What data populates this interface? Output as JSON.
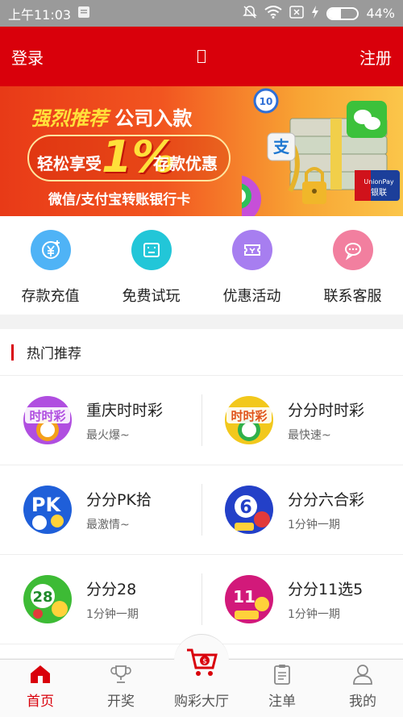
{
  "status_bar": {
    "time": "上午11:03",
    "battery_percent": "44%",
    "battery_level": 0.44
  },
  "header": {
    "login_label": "登录",
    "register_label": "注册"
  },
  "banner": {
    "line1_highlight": "强烈推荐",
    "line1_rest": "公司入款",
    "line2_prefix": "轻松享受",
    "percent": "1%",
    "line2_suffix": "存款优惠",
    "line3": "微信/支付宝转账银行卡",
    "unionpay_text": "UnionPay",
    "unionpay_cn": "银联"
  },
  "quick_actions": [
    {
      "label": "存款充值",
      "icon": "yen-plus-icon",
      "color": "#4fb3f6"
    },
    {
      "label": "免费试玩",
      "icon": "game-screen-icon",
      "color": "#22c6d8"
    },
    {
      "label": "优惠活动",
      "icon": "ticket-icon",
      "color": "#a77ef0"
    },
    {
      "label": "联系客服",
      "icon": "chat-bubble-icon",
      "color": "#f27f9f"
    }
  ],
  "section": {
    "title": "热门推荐"
  },
  "games": [
    {
      "name": "重庆时时彩",
      "desc": "最火爆~",
      "logo_color": "#b04ee0",
      "logo_text": "时时彩"
    },
    {
      "name": "分分时时彩",
      "desc": "最快速~",
      "logo_color": "#f2c81c",
      "logo_text": "时时彩"
    },
    {
      "name": "分分PK拾",
      "desc": "最激情~",
      "logo_color": "#1f5fd9",
      "logo_text": "PK"
    },
    {
      "name": "分分六合彩",
      "desc": "1分钟一期",
      "logo_color": "#2340c8",
      "logo_text": "6"
    },
    {
      "name": "分分28",
      "desc": "1分钟一期",
      "logo_color": "#3dbb35",
      "logo_text": "28"
    },
    {
      "name": "分分11选5",
      "desc": "1分钟一期",
      "logo_color": "#d2197a",
      "logo_text": "11"
    }
  ],
  "nav": [
    {
      "label": "首页",
      "icon": "home-icon",
      "active": true
    },
    {
      "label": "开奖",
      "icon": "trophy-icon",
      "active": false
    },
    {
      "label": "购彩大厅",
      "icon": "cart-icon",
      "active": false
    },
    {
      "label": "注单",
      "icon": "clipboard-icon",
      "active": false
    },
    {
      "label": "我的",
      "icon": "user-icon",
      "active": false
    }
  ],
  "colors": {
    "brand_red": "#d9000b",
    "status_bar": "#9a9a9a"
  }
}
